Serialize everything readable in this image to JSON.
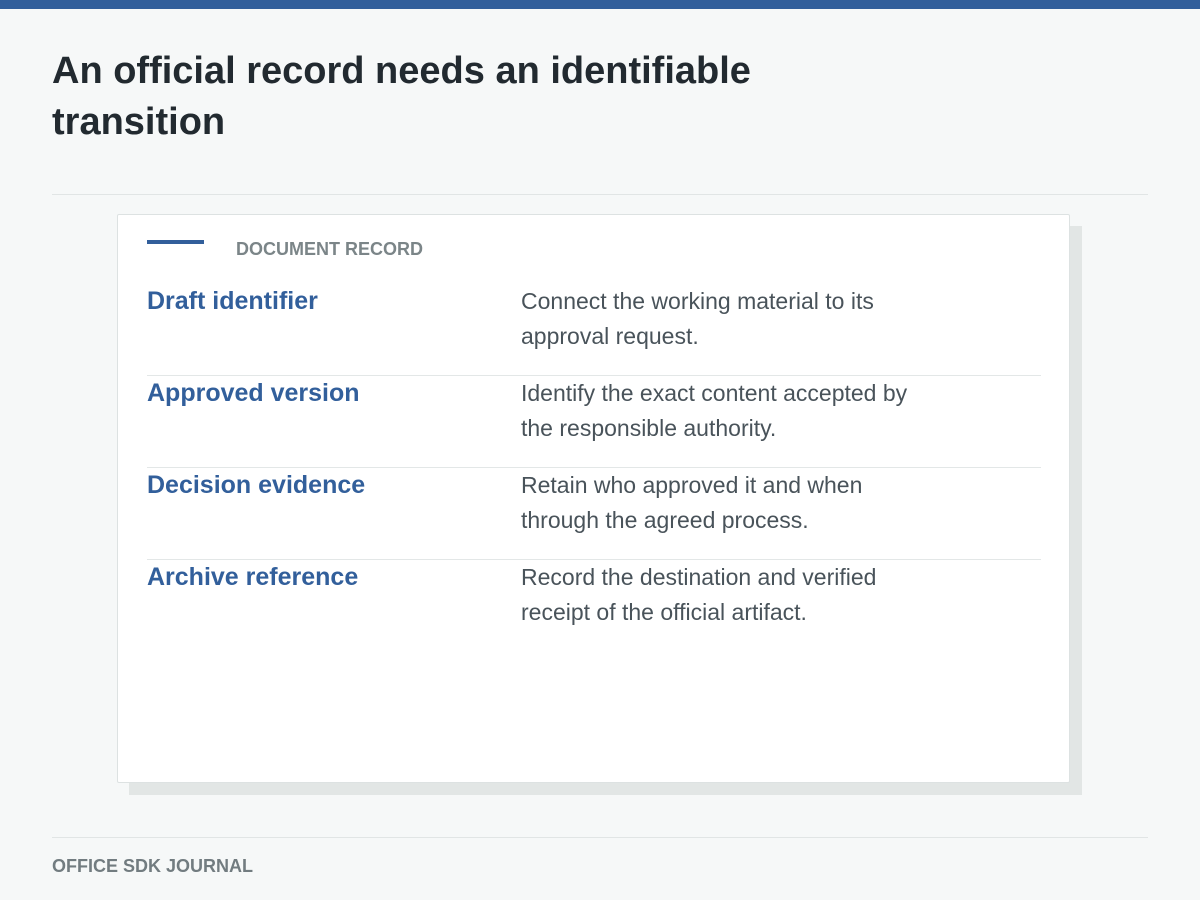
{
  "title": "An official record needs an identifiable transition",
  "card": {
    "label": "DOCUMENT RECORD",
    "rows": [
      {
        "term": "Draft identifier",
        "description": "Connect the working material to its approval request."
      },
      {
        "term": "Approved version",
        "description": "Identify the exact content accepted by the responsible authority."
      },
      {
        "term": "Decision evidence",
        "description": "Retain who approved it and when through the agreed process."
      },
      {
        "term": "Archive reference",
        "description": "Record the destination and verified receipt of the official artifact."
      }
    ]
  },
  "footer": {
    "label": "OFFICE SDK JOURNAL"
  },
  "colors": {
    "accent": "#325f9b",
    "title": "#222a30",
    "background": "#f6f8f8"
  }
}
